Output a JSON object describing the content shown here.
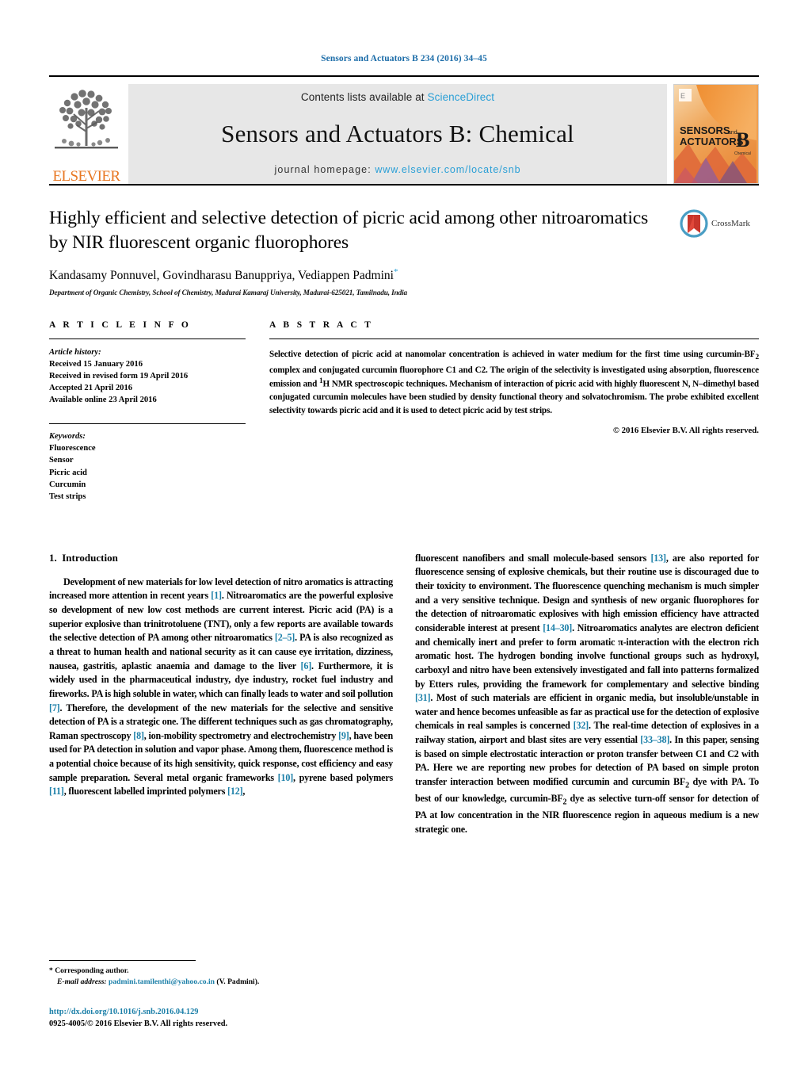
{
  "running_head": "Sensors and Actuators B 234 (2016) 34–45",
  "masthead": {
    "contents_prefix": "Contents lists available at ",
    "contents_link": "ScienceDirect",
    "journal_title": "Sensors and Actuators B: Chemical",
    "homepage_prefix": "journal homepage: ",
    "homepage_url": "www.elsevier.com/locate/snb",
    "publisher_wordmark": "ELSEVIER",
    "cover": {
      "line1": "SENSORS",
      "line1_suffix": "and",
      "line2": "ACTUATORS",
      "volume_letter": "B",
      "volume_sub": "Chemical"
    }
  },
  "article": {
    "title": "Highly efficient and selective detection of picric acid among other nitroaromatics by NIR fluorescent organic fluorophores",
    "authors": "Kandasamy Ponnuvel, Govindharasu Banuppriya, Vediappen Padmini",
    "corresponding_marker": "*",
    "affiliation": "Department of Organic Chemistry, School of Chemistry, Madurai Kamaraj University, Madurai-625021, Tamilnadu, India",
    "crossmark_label": "CrossMark"
  },
  "article_info": {
    "heading": "A R T I C L E   I N F O",
    "history_label": "Article history:",
    "history": [
      "Received 15 January 2016",
      "Received in revised form 19 April 2016",
      "Accepted 21  April 2016",
      "Available online 23 April 2016"
    ],
    "keywords_label": "Keywords:",
    "keywords": [
      "Fluorescence",
      "Sensor",
      "Picric acid",
      "Curcumin",
      "Test strips"
    ]
  },
  "abstract": {
    "heading": "A B S T R A C T",
    "part1": "Selective detection of picric acid at nanomolar concentration is achieved in water medium for the first time using curcumin-BF",
    "sub1": "2",
    "part2": " complex and conjugated curcumin fluorophore C1 and C2. The origin of the selectivity is investigated using absorption, fluorescence emission and ",
    "sup1": "1",
    "part3": "H NMR spectroscopic techniques. Mechanism of interaction of picric acid with highly fluorescent N, N–dimethyl based conjugated curcumin molecules have been studied by density functional theory and solvatochromism. The probe exhibited excellent selectivity towards picric acid and it is used to detect picric acid by test strips.",
    "copyright": "© 2016 Elsevier B.V. All rights reserved."
  },
  "introduction": {
    "section_number": "1.",
    "section_title": "Introduction",
    "left_paragraph": {
      "t1": "Development of new materials for low level detection of nitro aromatics is attracting increased more attention in recent years ",
      "c1": "[1]",
      "t2": ". Nitroaromatics are the powerful explosive so development of new low cost methods are current interest. Picric acid (PA) is a superior explosive than trinitrotoluene (TNT), only a few reports are available towards the selective detection of PA among other nitroaromatics ",
      "c2": "[2–5]",
      "t3": ". PA is also recognized as a threat to human health and national security as it can cause eye irritation, dizziness, nausea, gastritis, aplastic anaemia and damage to the liver ",
      "c3": "[6]",
      "t4": ". Furthermore, it is widely used in the pharmaceutical industry, dye industry, rocket fuel industry and fireworks. PA is high soluble in water, which can finally leads to water and soil pollution ",
      "c4": "[7]",
      "t5": ". Therefore, the development of the new materials for the selective and sensitive detection of PA is a strategic one. The different techniques such as gas chromatography, Raman spectroscopy ",
      "c5": "[8]",
      "t6": ", ion-mobility spectrometry and electrochemistry ",
      "c6": "[9]",
      "t7": ", have been used for PA detection in solution and vapor phase. Among them, fluorescence method is a potential choice because of its high sensitivity, quick response, cost efficiency and easy sample preparation. Several metal organic frameworks ",
      "c7": "[10]",
      "t8": ", pyrene based polymers ",
      "c8": "[11]",
      "t9": ", fluorescent labelled imprinted polymers ",
      "c9": "[12]",
      "t10": ","
    },
    "right_paragraph": {
      "t1": "fluorescent nanofibers and small molecule-based sensors ",
      "c1": "[13]",
      "t2": ", are also reported for fluorescence sensing of explosive chemicals, but their routine use is discouraged due to their toxicity to environment. The fluorescence quenching mechanism is much simpler and a very sensitive technique. Design and synthesis of new organic fluorophores for the detection of nitroaromatic explosives with high emission efficiency have attracted considerable interest at present ",
      "c2": "[14–30]",
      "t3": ". Nitroaromatics analytes are electron deficient and chemically inert and prefer to form aromatic π-interaction with the electron rich aromatic host. The hydrogen bonding involve functional groups such as hydroxyl, carboxyl and nitro have been extensively investigated and fall into patterns formalized by Etters rules, providing the framework for complementary and selective binding ",
      "c3": "[31]",
      "t4": ". Most of such materials are efficient in organic media, but insoluble/unstable in water and hence becomes unfeasible as far as practical use for the detection of explosive chemicals in real samples is concerned ",
      "c4": "[32]",
      "t5": ". The real-time detection of explosives in a railway station, airport and blast sites are very essential ",
      "c5": "[33–38]",
      "t6": ". In this paper, sensing is based on simple electrostatic interaction or proton transfer between C1 and C2 with PA. Here we are reporting new probes for detection of PA based on simple proton transfer interaction between modified curcumin and curcumin BF",
      "sub1": "2",
      "t7": " dye with PA. To best of our knowledge, curcumin-BF",
      "sub2": "2",
      "t8": " dye as selective turn-off sensor for detection of PA at low concentration in the NIR fluorescence region in aqueous medium is a new strategic one."
    }
  },
  "footer": {
    "corresponding_marker": "*",
    "corresponding_label": "Corresponding author.",
    "email_label": "E-mail address:",
    "email": "padmini.tamilenthi@yahoo.co.in",
    "email_owner": "(V. Padmini).",
    "doi": "http://dx.doi.org/10.1016/j.snb.2016.04.129",
    "issn_line": "0925-4005/© 2016 Elsevier B.V. All rights reserved."
  },
  "colors": {
    "link_blue": "#2a9fd6",
    "cite_blue": "#1b7fa8",
    "elsevier_orange": "#E87722",
    "banner_gray": "#e7e7e7"
  }
}
